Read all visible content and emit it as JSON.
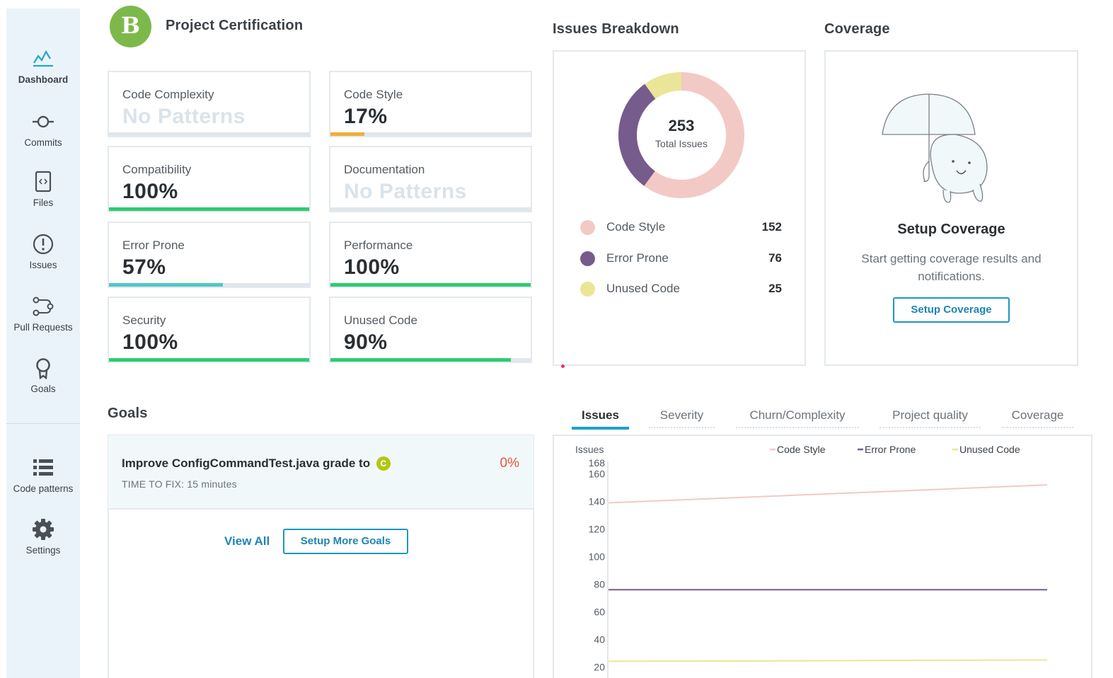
{
  "sidebar": {
    "items": [
      {
        "label": "Dashboard",
        "icon": "dashboard-icon"
      },
      {
        "label": "Commits",
        "icon": "commit-icon"
      },
      {
        "label": "Files",
        "icon": "file-code-icon"
      },
      {
        "label": "Issues",
        "icon": "alert-circle-icon"
      },
      {
        "label": "Pull Requests",
        "icon": "pull-request-icon"
      },
      {
        "label": "Goals",
        "icon": "target-icon"
      },
      {
        "label": "Code patterns",
        "icon": "list-icon"
      },
      {
        "label": "Settings",
        "icon": "gear-icon"
      }
    ]
  },
  "certification": {
    "grade": "B",
    "title": "Project Certification",
    "grade_color": "#7cb94a",
    "metrics": [
      {
        "name": "Code Complexity",
        "value": "No Patterns",
        "fill": 0,
        "color": "#dfe6ec"
      },
      {
        "name": "Code Style",
        "value": "17%",
        "fill": 0.17,
        "color": "#f0ad37"
      },
      {
        "name": "Compatibility",
        "value": "100%",
        "fill": 1.0,
        "color": "#2ecc71"
      },
      {
        "name": "Documentation",
        "value": "No Patterns",
        "fill": 0,
        "color": "#dfe6ec"
      },
      {
        "name": "Error Prone",
        "value": "57%",
        "fill": 0.57,
        "color": "#4fc8c8"
      },
      {
        "name": "Performance",
        "value": "100%",
        "fill": 1.0,
        "color": "#2ecc71"
      },
      {
        "name": "Security",
        "value": "100%",
        "fill": 1.0,
        "color": "#2ecc71"
      },
      {
        "name": "Unused Code",
        "value": "90%",
        "fill": 0.9,
        "color": "#2ecc71"
      }
    ]
  },
  "issues_breakdown": {
    "title": "Issues Breakdown",
    "total": "253",
    "total_label": "Total Issues",
    "items": [
      {
        "name": "Code Style",
        "count": 152,
        "color": "#f2c9c5"
      },
      {
        "name": "Error Prone",
        "count": 76,
        "color": "#765b8d"
      },
      {
        "name": "Unused Code",
        "count": 25,
        "color": "#ebe597"
      }
    ]
  },
  "coverage": {
    "title": "Coverage",
    "heading": "Setup Coverage",
    "description": "Start getting coverage results and notifications.",
    "button": "Setup Coverage"
  },
  "goals": {
    "title": "Goals",
    "goal_text": "Improve ConfigCommandTest.java grade to",
    "goal_grade": "C",
    "goal_percent": "0%",
    "time_to_fix": "TIME TO FIX: 15 minutes",
    "view_all": "View All",
    "setup_more": "Setup More Goals"
  },
  "tabs": [
    "Issues",
    "Severity",
    "Churn/Complexity",
    "Project quality",
    "Coverage"
  ],
  "chart_data": {
    "type": "line",
    "ylabel": "Issues",
    "y_ticks": [
      20,
      40,
      60,
      80,
      100,
      120,
      140,
      160,
      168
    ],
    "ylim": [
      15,
      168
    ],
    "x": [
      0,
      1
    ],
    "series": [
      {
        "name": "Code Style",
        "color": "#f2c9c5",
        "values": [
          139,
          152
        ]
      },
      {
        "name": "Error Prone",
        "color": "#765b8d",
        "values": [
          76,
          76
        ]
      },
      {
        "name": "Unused Code",
        "color": "#ebe597",
        "values": [
          24,
          25
        ]
      }
    ],
    "legend": "top",
    "grid": false
  }
}
